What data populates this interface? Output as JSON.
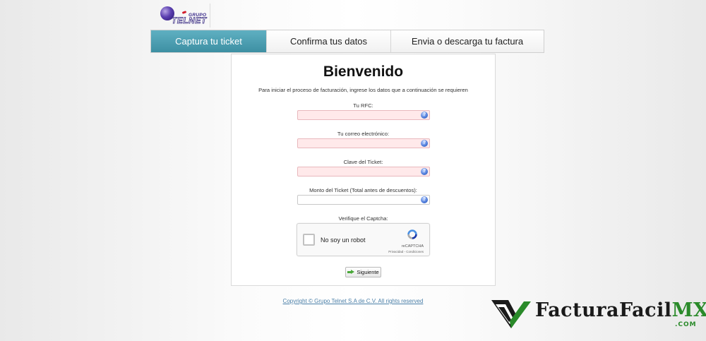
{
  "logo": {
    "top": "GRUPO",
    "name": "TELNET"
  },
  "tabs": [
    {
      "label": "Captura tu ticket",
      "active": true
    },
    {
      "label": "Confirma tus datos",
      "active": false
    },
    {
      "label": "Envia o descarga tu factura",
      "active": false
    }
  ],
  "form": {
    "title": "Bienvenido",
    "intro": "Para iniciar el proceso de facturación, ingrese los datos que a continuación se requieren",
    "fields": [
      {
        "label": "Tu RFC:",
        "value": "",
        "required": true
      },
      {
        "label": "Tu correo electrónico:",
        "value": "",
        "required": true
      },
      {
        "label": "Clave del Ticket:",
        "value": "",
        "required": true
      },
      {
        "label": "Monto del Ticket (Total antes de descuentos):",
        "value": "",
        "required": false
      }
    ],
    "help_glyph": "?",
    "captcha_label": "Verifique el Captcha:",
    "captcha": {
      "checkbox_text": "No soy un robot",
      "brand": "reCAPTCHA",
      "terms": "Privacidad - Condiciones"
    },
    "submit_label": "Siguiente"
  },
  "footer": {
    "copyright": "Copyright © Grupo Telnet S.A de C.V. All rights reserved"
  },
  "watermark": {
    "name": "FacturaFacil",
    "suffix": "MX",
    "domain": ".COM"
  },
  "colors": {
    "active_tab": "#4a9db1",
    "required_field": "#ffe9ea",
    "link": "#4a7fa8",
    "watermark_green": "#2a8a2a"
  }
}
